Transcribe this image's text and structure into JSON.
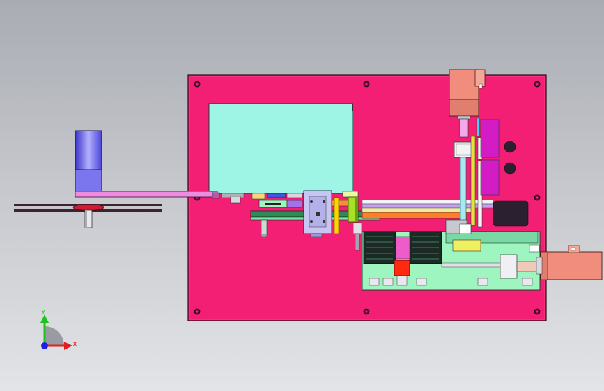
{
  "viewport": {
    "background_top": "#a9acb3",
    "background_bottom": "#e3e4e7"
  },
  "model": {
    "base_plate_color": "#f21f74",
    "base_plate_edge": "#2a0a16",
    "panel_color": "#9ef5e5",
    "motor_body_color": "#f08d7d",
    "motor_blue_color": "#7b76ee",
    "bracket_green_color": "#78e6a8",
    "rail_green_color": "#2f8a56",
    "belt_orange_color": "#ff7e29",
    "arm_pink_color": "#ee5cc9",
    "pulley_red_color": "#d11a30"
  },
  "triad": {
    "x_label": "X",
    "y_label": "Y",
    "x_color": "#e02020",
    "y_color": "#1ec21e",
    "origin_color": "#2020e0"
  }
}
